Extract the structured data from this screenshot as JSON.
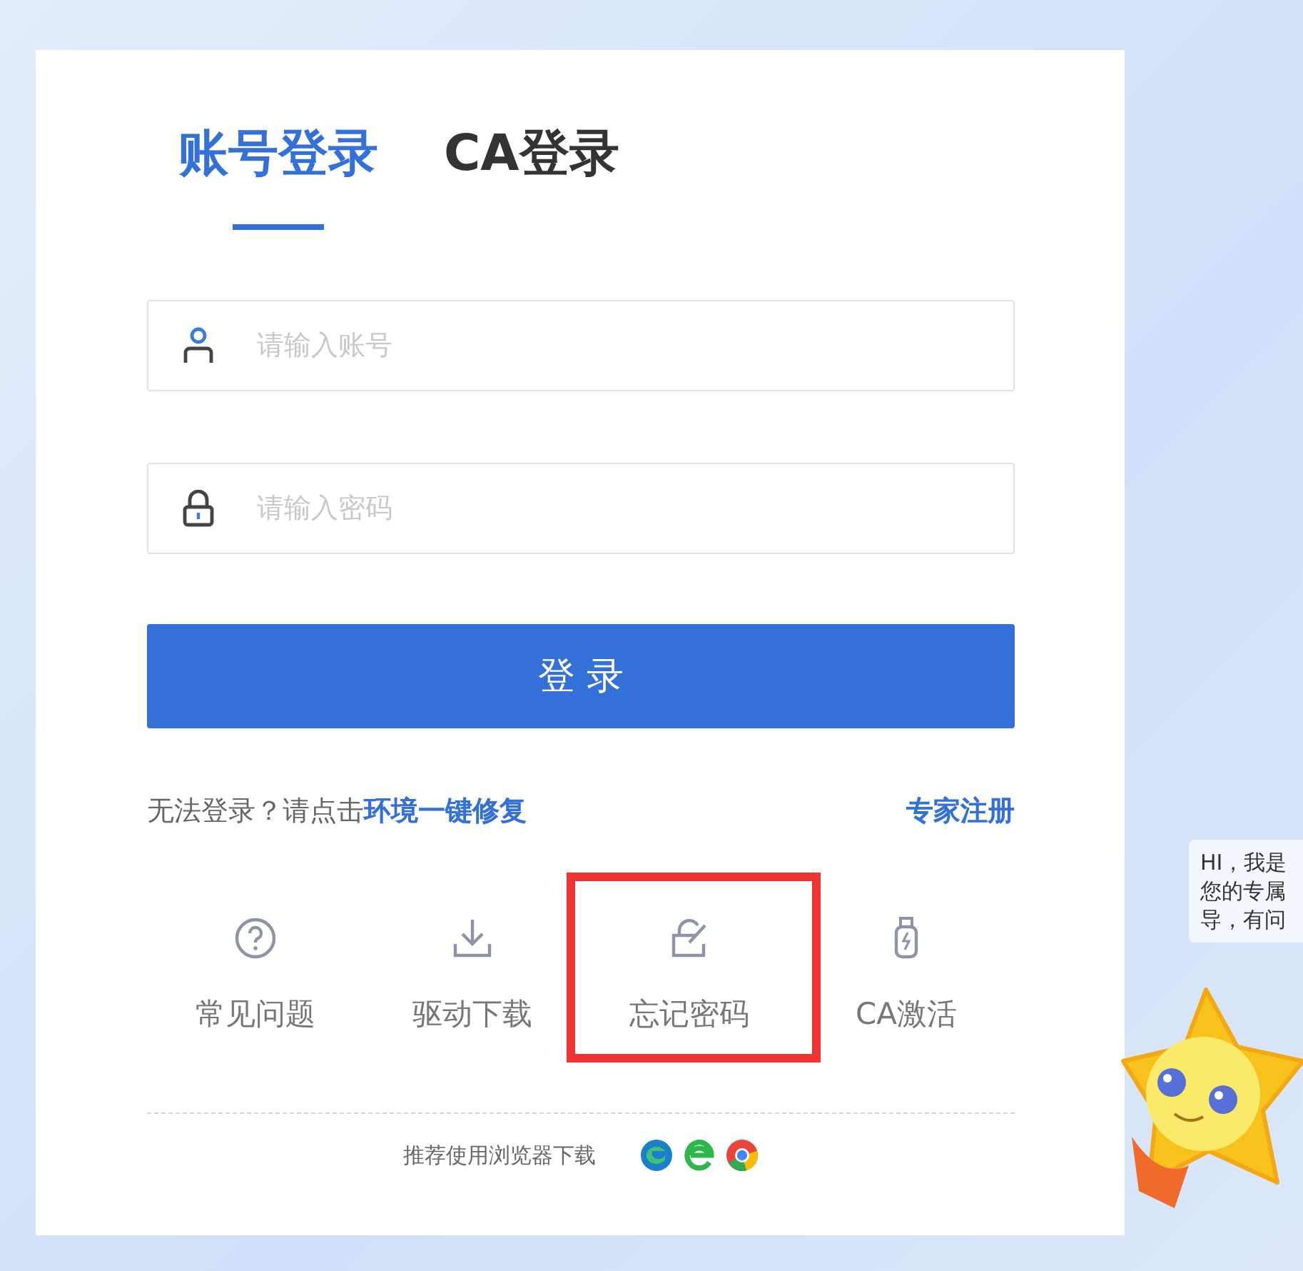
{
  "tabs": [
    {
      "label": "账号登录",
      "selected": true
    },
    {
      "label": "CA登录",
      "selected": false
    }
  ],
  "fields": [
    {
      "kind": "account",
      "placeholder": "请输入账号"
    },
    {
      "kind": "password",
      "placeholder": "请输入密码"
    }
  ],
  "login_button": "登 录",
  "help_text": "无法登录？请点击",
  "repair_link": "环境一键修复",
  "register_link": "专家注册",
  "shortcuts": [
    {
      "kind": "help",
      "label": "常见问题",
      "highlighted": false
    },
    {
      "kind": "download",
      "label": "驱动下载",
      "highlighted": false
    },
    {
      "kind": "forgot",
      "label": "忘记密码",
      "highlighted": true
    },
    {
      "kind": "usbkey",
      "label": "CA激活",
      "highlighted": false
    }
  ],
  "footer": {
    "text": "推荐使用浏览器下载",
    "browsers": [
      {
        "kind": "edge"
      },
      {
        "kind": "ie"
      },
      {
        "kind": "chrome"
      }
    ]
  },
  "assistant": {
    "bubble_lines": [
      "HI，我是",
      "您的专属",
      "导，有问"
    ]
  }
}
